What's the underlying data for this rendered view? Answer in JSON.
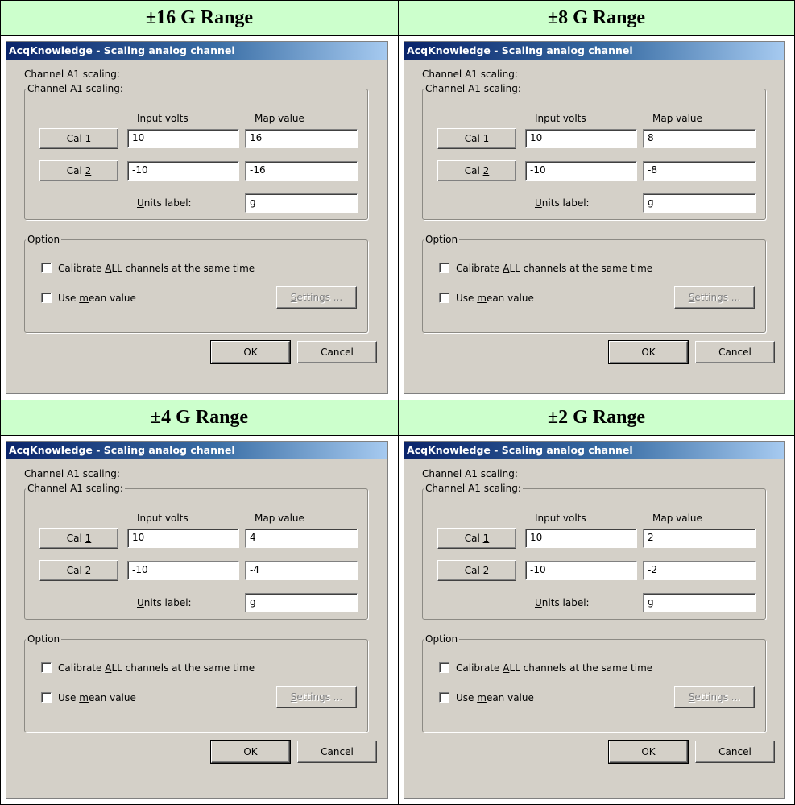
{
  "panels": [
    {
      "header": "±16 G Range",
      "title": "AcqKnowledge - Scaling analog channel",
      "channel_label": "Channel A1 scaling:",
      "group_legend": "Channel A1 scaling:",
      "input_volts_header": "Input volts",
      "map_value_header": "Map value",
      "cal1": {
        "button": "Cal 1",
        "input_volts": "10",
        "map_value": "16"
      },
      "cal2": {
        "button": "Cal 2",
        "input_volts": "-10",
        "map_value": "-16"
      },
      "units_label": "Units label:",
      "units_value": "g",
      "option_legend": "Option",
      "calibrate_all": "Calibrate ALL channels at the same time",
      "calibrate_all_checked": false,
      "use_mean": "Use mean value",
      "use_mean_checked": false,
      "settings": "Settings ...",
      "ok": "OK",
      "cancel": "Cancel"
    },
    {
      "header": "±8 G Range",
      "title": "AcqKnowledge - Scaling analog channel",
      "channel_label": "Channel A1 scaling:",
      "group_legend": "Channel A1 scaling:",
      "input_volts_header": "Input volts",
      "map_value_header": "Map value",
      "cal1": {
        "button": "Cal 1",
        "input_volts": "10",
        "map_value": "8"
      },
      "cal2": {
        "button": "Cal 2",
        "input_volts": "-10",
        "map_value": "-8"
      },
      "units_label": "Units label:",
      "units_value": "g",
      "option_legend": "Option",
      "calibrate_all": "Calibrate ALL channels at the same time",
      "calibrate_all_checked": false,
      "use_mean": "Use mean value",
      "use_mean_checked": false,
      "settings": "Settings ...",
      "ok": "OK",
      "cancel": "Cancel"
    },
    {
      "header": "±4 G Range",
      "title": "AcqKnowledge - Scaling analog channel",
      "channel_label": "Channel A1 scaling:",
      "group_legend": "Channel A1 scaling:",
      "input_volts_header": "Input volts",
      "map_value_header": "Map value",
      "cal1": {
        "button": "Cal 1",
        "input_volts": "10",
        "map_value": "4"
      },
      "cal2": {
        "button": "Cal 2",
        "input_volts": "-10",
        "map_value": "-4"
      },
      "units_label": "Units label:",
      "units_value": "g",
      "option_legend": "Option",
      "calibrate_all": "Calibrate ALL channels at the same time",
      "calibrate_all_checked": false,
      "use_mean": "Use mean value",
      "use_mean_checked": false,
      "settings": "Settings ...",
      "ok": "OK",
      "cancel": "Cancel"
    },
    {
      "header": "±2 G Range",
      "title": "AcqKnowledge - Scaling analog channel",
      "channel_label": "Channel A1 scaling:",
      "group_legend": "Channel A1 scaling:",
      "input_volts_header": "Input volts",
      "map_value_header": "Map value",
      "cal1": {
        "button": "Cal 1",
        "input_volts": "10",
        "map_value": "2"
      },
      "cal2": {
        "button": "Cal 2",
        "input_volts": "-10",
        "map_value": "-2"
      },
      "units_label": "Units label:",
      "units_value": "g",
      "option_legend": "Option",
      "calibrate_all": "Calibrate ALL channels at the same time",
      "calibrate_all_checked": false,
      "use_mean": "Use mean value",
      "use_mean_checked": false,
      "settings": "Settings ...",
      "ok": "OK",
      "cancel": "Cancel"
    }
  ],
  "colors": {
    "header_background": "#ccffcc",
    "dialog_face": "#d4d0c8",
    "title_bar_start": "#0a246a",
    "title_bar_end": "#a6caf0"
  }
}
